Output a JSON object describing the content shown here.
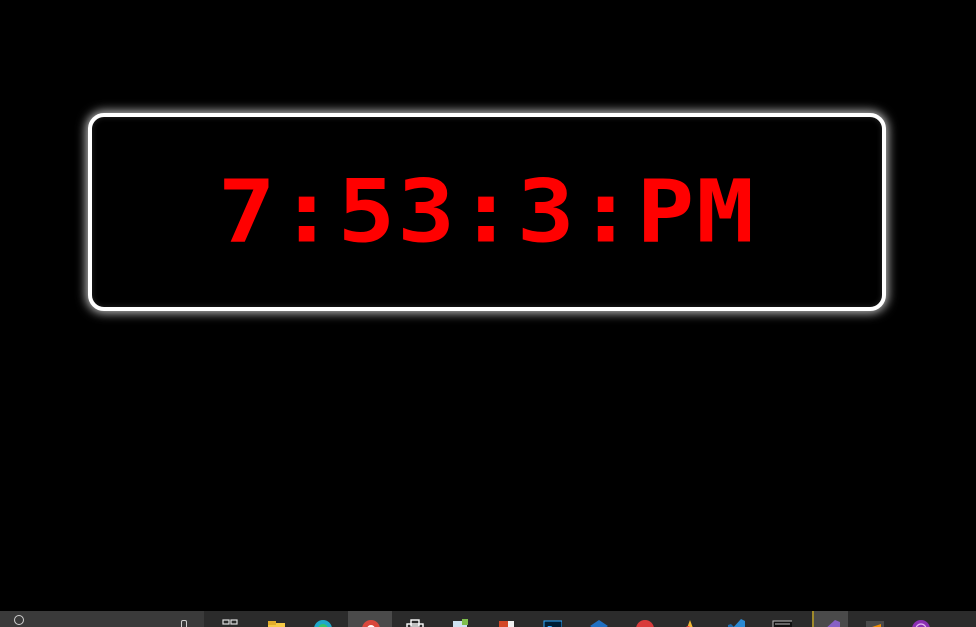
{
  "clock": {
    "time_text": "7:53:3:PM",
    "text_color": "#ff0000",
    "frame_color": "#ffffff",
    "background": "#000000"
  },
  "taskbar": {
    "background": "#2b2b2b",
    "icons": [
      "search-icon",
      "microphone-icon",
      "task-view-icon",
      "file-explorer-icon",
      "edge-browser-icon",
      "chrome-browser-icon",
      "store-icon",
      "notepad-icon",
      "powerpoint-icon",
      "photoshop-icon",
      "app-blue-icon",
      "app-red-icon",
      "paint-icon",
      "vscode-icon",
      "terminal-icon",
      "visual-studio-icon",
      "sublime-icon",
      "app-purple-icon"
    ]
  }
}
